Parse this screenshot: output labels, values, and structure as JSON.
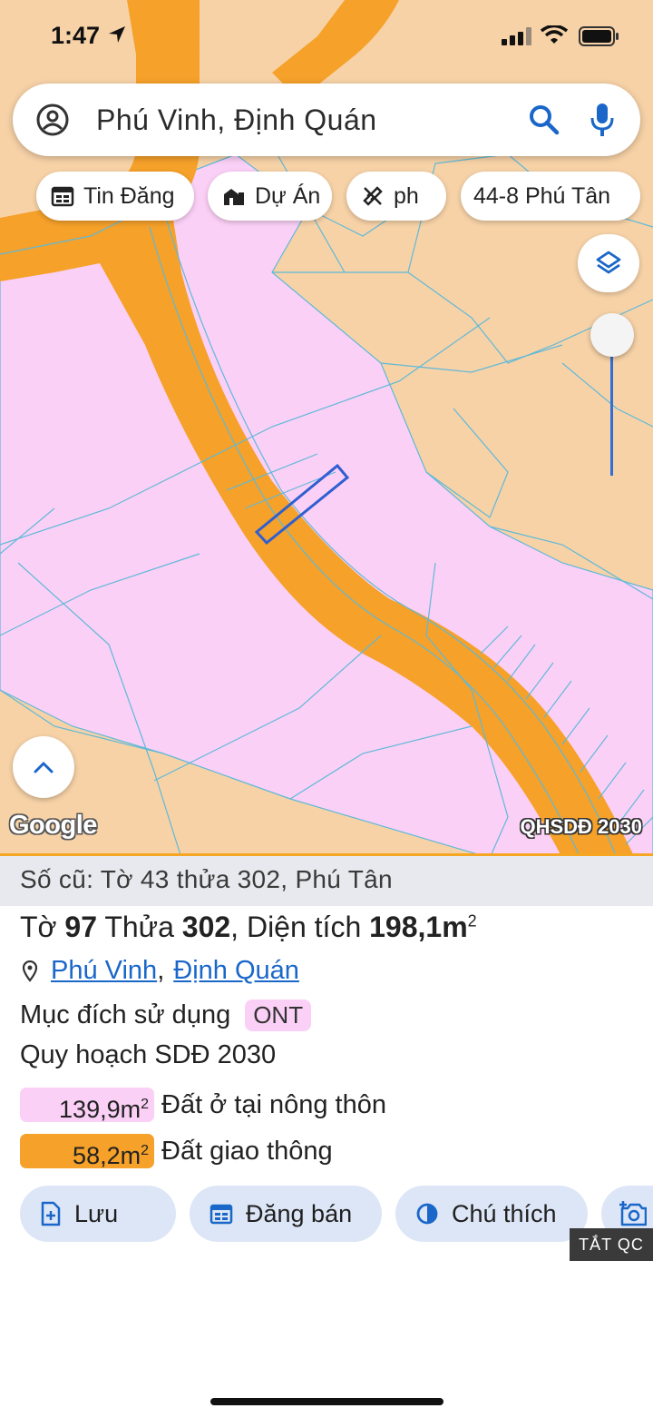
{
  "status_bar": {
    "time": "1:47"
  },
  "search": {
    "query": "Phú Vinh, Định Quán"
  },
  "chips": [
    {
      "label": "Tin Đăng",
      "icon": "calendar-icon"
    },
    {
      "label": "Dự Án",
      "icon": "building-icon"
    },
    {
      "label": "ph",
      "icon": "ruler-pencil-icon"
    },
    {
      "label": "44-8 Phú Tân",
      "icon": ""
    }
  ],
  "map": {
    "attribution": "Google",
    "layer_label": "QHSDĐ 2030",
    "colors": {
      "land": "#f7d2a7",
      "residential": "#fbd0f6",
      "road": "#f5a12a",
      "parcel_lines": "#5fb9d8",
      "selected_parcel": "#2f5fd0"
    }
  },
  "parcel": {
    "old_ref": "Số cũ: Tờ 43 thửa 302, Phú Tân",
    "to_label": "Tờ",
    "to_value": "97",
    "thua_label": "Thửa",
    "thua_value": "302",
    "area_label": ", Diện tích",
    "area_value": "198,1m",
    "area_sup": "2",
    "ward": "Phú Vinh",
    "district": "Định Quán",
    "purpose_label": "Mục đích sử dụng",
    "purpose_code": "ONT",
    "plan_label": "Quy hoạch SDĐ 2030",
    "zones": [
      {
        "area": "139,9m",
        "sup": "2",
        "label": "Đất ở tại nông thôn",
        "color": "#fbd0f6"
      },
      {
        "area": "58,2m",
        "sup": "2",
        "label": "Đất giao thông",
        "color": "#f5a12a"
      }
    ]
  },
  "actions": [
    {
      "label": "Lưu",
      "icon": "add-document-icon"
    },
    {
      "label": "Đăng bán",
      "icon": "calendar-icon"
    },
    {
      "label": "Chú thích",
      "icon": "contrast-icon"
    },
    {
      "label": "",
      "icon": "camera-add-icon"
    }
  ],
  "ad_tag": "TẮT QC"
}
